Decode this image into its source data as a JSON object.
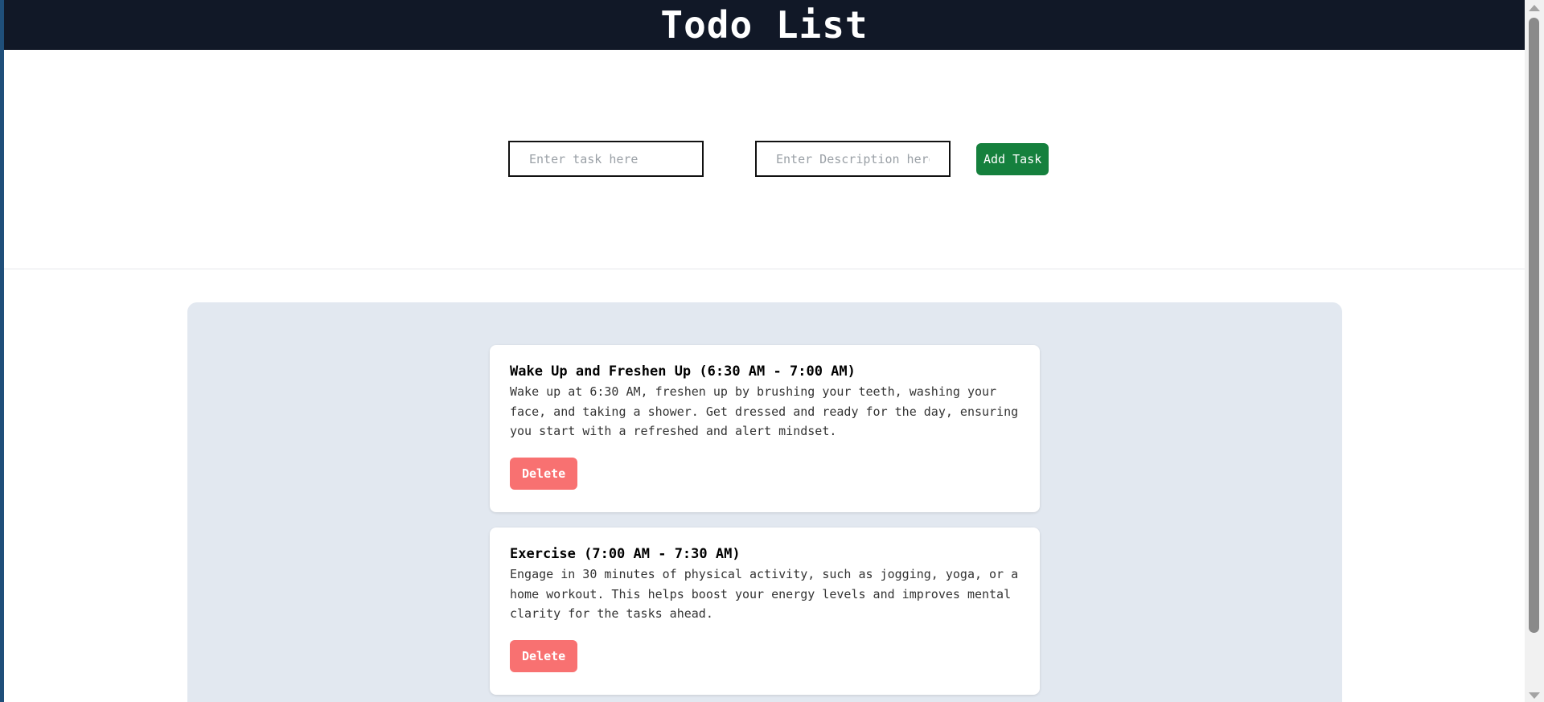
{
  "header": {
    "title": "Todo List"
  },
  "form": {
    "task_placeholder": "Enter task here",
    "description_placeholder": "Enter Description here",
    "add_label": "Add Task"
  },
  "tasks": [
    {
      "title": "Wake Up and Freshen Up (6:30 AM - 7:00 AM)",
      "description": "Wake up at 6:30 AM, freshen up by brushing your teeth, washing your face, and taking a shower. Get dressed and ready for the day, ensuring you start with a refreshed and alert mindset.",
      "delete_label": "Delete"
    },
    {
      "title": "Exercise (7:00 AM - 7:30 AM)",
      "description": "Engage in 30 minutes of physical activity, such as jogging, yoga, or a home workout. This helps boost your energy levels and improves mental clarity for the tasks ahead.",
      "delete_label": "Delete"
    }
  ],
  "colors": {
    "header_bg": "#111827",
    "add_button": "#15803d",
    "delete_button": "#f87171",
    "board_bg": "#e2e8f0"
  }
}
